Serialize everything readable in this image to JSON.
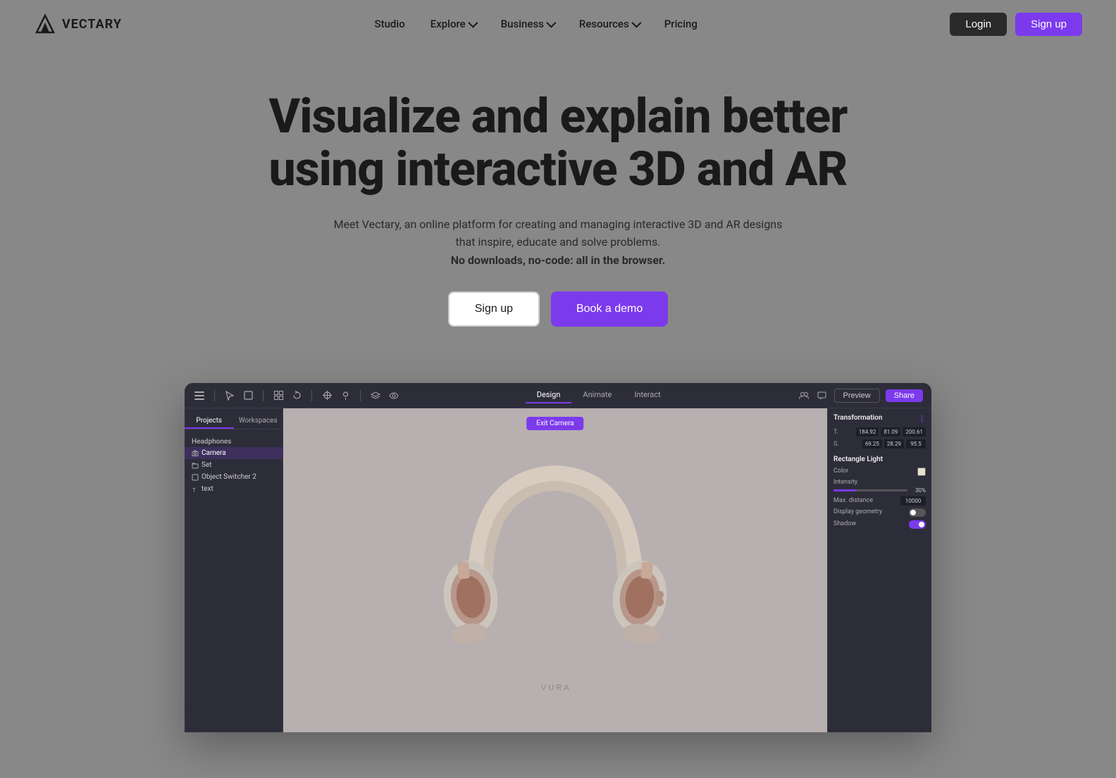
{
  "brand": {
    "name": "VECTARY",
    "logo_text": "VECTARY"
  },
  "nav": {
    "links": [
      {
        "id": "studio",
        "label": "Studio",
        "has_dropdown": false
      },
      {
        "id": "explore",
        "label": "Explore",
        "has_dropdown": true
      },
      {
        "id": "business",
        "label": "Business",
        "has_dropdown": true
      },
      {
        "id": "resources",
        "label": "Resources",
        "has_dropdown": true
      },
      {
        "id": "pricing",
        "label": "Pricing",
        "has_dropdown": false
      }
    ],
    "login_label": "Login",
    "signup_label": "Sign up"
  },
  "hero": {
    "title": "Visualize and explain better using interactive 3D and AR",
    "subtitle": "Meet Vectary, an online platform for creating and managing interactive 3D and AR designs that inspire, educate and solve problems.",
    "subtitle_bold": "No downloads, no-code: all in the browser.",
    "cta_signup": "Sign up",
    "cta_demo": "Book a demo"
  },
  "app_preview": {
    "toolbar": {
      "tabs": [
        "Design",
        "Animate",
        "Interact"
      ],
      "active_tab": "Design",
      "btn_preview": "Preview",
      "btn_share": "Share"
    },
    "left_panel": {
      "tabs": [
        "Projects",
        "Workspaces"
      ],
      "active_tab": "Projects",
      "header": "Headphones",
      "items": [
        {
          "label": "Camera",
          "icon": "camera"
        },
        {
          "label": "Set",
          "icon": "folder"
        },
        {
          "label": "Object Switcher 2",
          "icon": "object"
        },
        {
          "label": "text",
          "icon": "text"
        }
      ]
    },
    "canvas": {
      "exit_camera_btn": "Exit Camera"
    },
    "right_panel": {
      "title": "Transformation",
      "position_label": "T.",
      "position_x": "184.92",
      "position_y": "81.09",
      "position_z": "200.61",
      "scale_label": "S.",
      "scale_x": "69.25",
      "scale_y": "28.29",
      "scale_z": "95.5",
      "section2_title": "Rectangle Light",
      "color_label": "Color",
      "intensity_label": "Intensity",
      "intensity_value": "30%",
      "max_distance_label": "Max. distance",
      "max_distance_value": "10000",
      "display_geometry_label": "Display geometry",
      "shadow_label": "Shadow"
    }
  }
}
